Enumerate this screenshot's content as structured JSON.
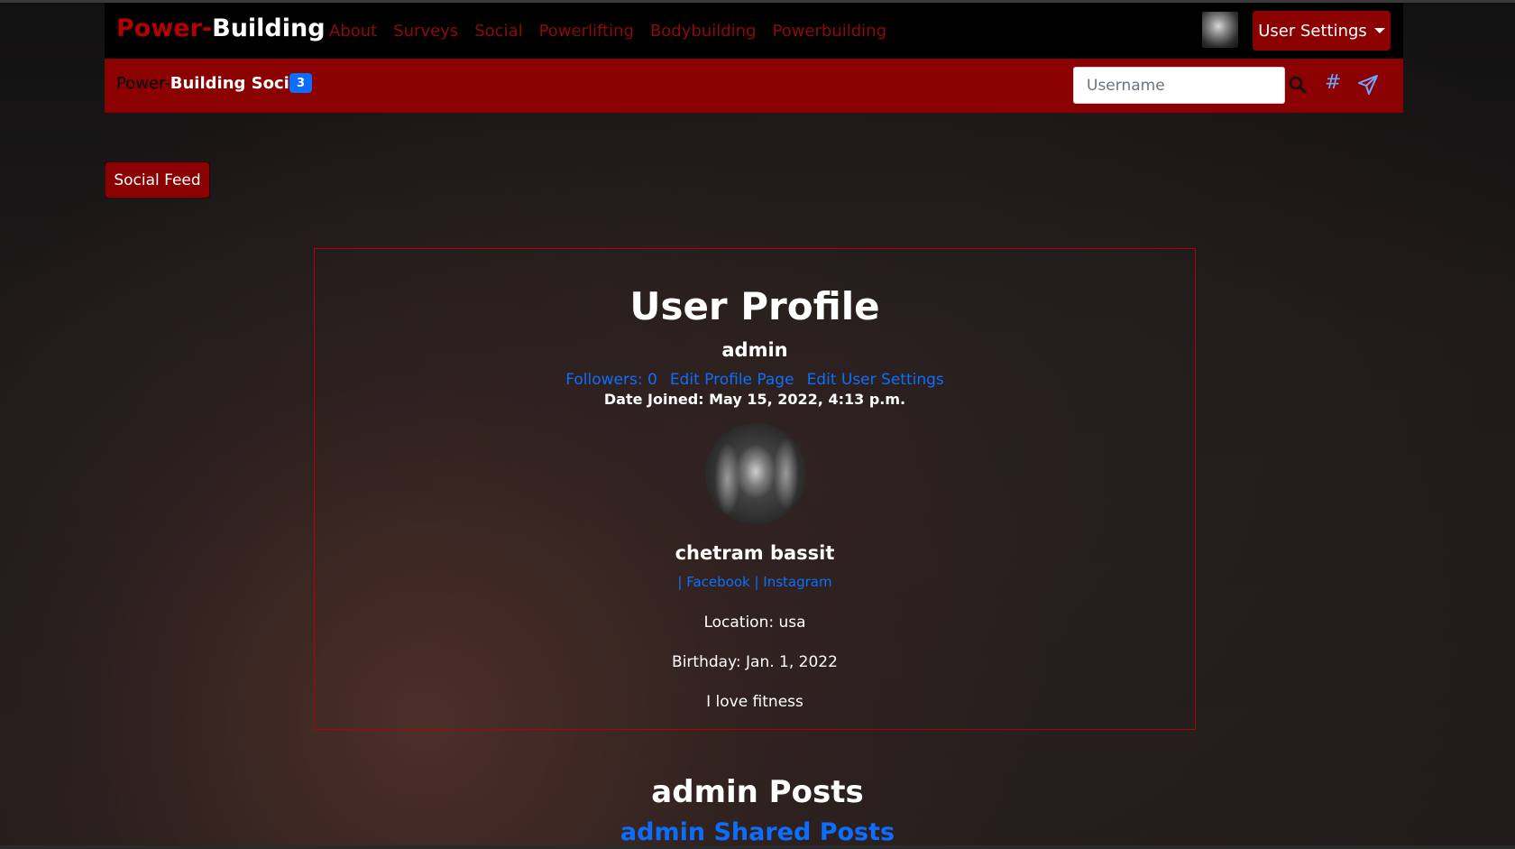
{
  "navbar": {
    "brand_part1": "Power-",
    "brand_part2": "Building",
    "links": [
      "About",
      "Surveys",
      "Social",
      "Powerlifting",
      "Bodybuilding",
      "Powerbuilding"
    ],
    "user_settings_label": "User Settings"
  },
  "subbar": {
    "title_part1": "Power-",
    "title_part2": "Building Social",
    "badge_count": "3",
    "search_placeholder": "Username",
    "hash_symbol": "#"
  },
  "social_feed_label": "Social Feed",
  "profile": {
    "title": "User Profile",
    "username": "admin",
    "followers": "Followers: 0",
    "edit_profile": "Edit Profile Page",
    "edit_settings": "Edit User Settings",
    "date_joined": "Date Joined: May 15, 2022, 4:13 p.m.",
    "full_name": "chetram bassit",
    "facebook": "Facebook",
    "instagram": "Instagram",
    "location": "Location: usa",
    "birthday": "Birthday: Jan. 1, 2022",
    "bio": "I love fitness"
  },
  "posts": {
    "title": "admin Posts",
    "shared_title": "admin Shared Posts"
  },
  "colors": {
    "brand_red": "#8b0000",
    "link_blue": "#0d6efd"
  }
}
